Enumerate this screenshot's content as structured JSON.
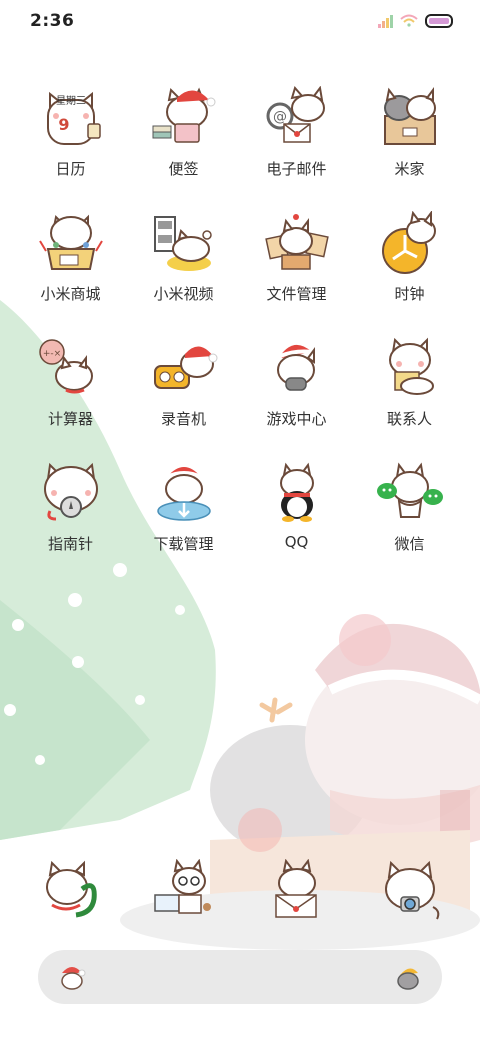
{
  "status_bar": {
    "time": "2:36"
  },
  "apps": [
    {
      "label": "日历",
      "name": "app-calendar",
      "icon": "calendar-cat-icon",
      "badge": "星期三",
      "date": "9"
    },
    {
      "label": "便签",
      "name": "app-notes",
      "icon": "notes-cat-icon"
    },
    {
      "label": "电子邮件",
      "name": "app-email",
      "icon": "email-cat-icon"
    },
    {
      "label": "米家",
      "name": "app-mijia",
      "icon": "mijia-cat-icon"
    },
    {
      "label": "小米商城",
      "name": "app-mi-store",
      "icon": "store-cat-icon"
    },
    {
      "label": "小米视频",
      "name": "app-mi-video",
      "icon": "video-cat-icon"
    },
    {
      "label": "文件管理",
      "name": "app-file-manager",
      "icon": "files-cat-icon"
    },
    {
      "label": "时钟",
      "name": "app-clock",
      "icon": "clock-cat-icon"
    },
    {
      "label": "计算器",
      "name": "app-calculator",
      "icon": "calculator-cat-icon"
    },
    {
      "label": "录音机",
      "name": "app-recorder",
      "icon": "recorder-cat-icon"
    },
    {
      "label": "游戏中心",
      "name": "app-game-center",
      "icon": "game-cat-icon"
    },
    {
      "label": "联系人",
      "name": "app-contacts",
      "icon": "contacts-cat-icon"
    },
    {
      "label": "指南针",
      "name": "app-compass",
      "icon": "compass-cat-icon"
    },
    {
      "label": "下载管理",
      "name": "app-downloads",
      "icon": "download-cat-icon"
    },
    {
      "label": "QQ",
      "name": "app-qq",
      "icon": "qq-penguin-cat-icon"
    },
    {
      "label": "微信",
      "name": "app-wechat",
      "icon": "wechat-cat-icon"
    }
  ],
  "dock": [
    {
      "name": "dock-phone",
      "icon": "phone-cat-icon"
    },
    {
      "name": "dock-browser",
      "icon": "browser-cat-icon"
    },
    {
      "name": "dock-messages",
      "icon": "messages-cat-icon"
    },
    {
      "name": "dock-camera",
      "icon": "camera-cat-icon"
    }
  ],
  "colors": {
    "accent_red": "#e2463f",
    "tree_green": "#cfe9d5",
    "cat_outline": "#6b4a3a"
  }
}
